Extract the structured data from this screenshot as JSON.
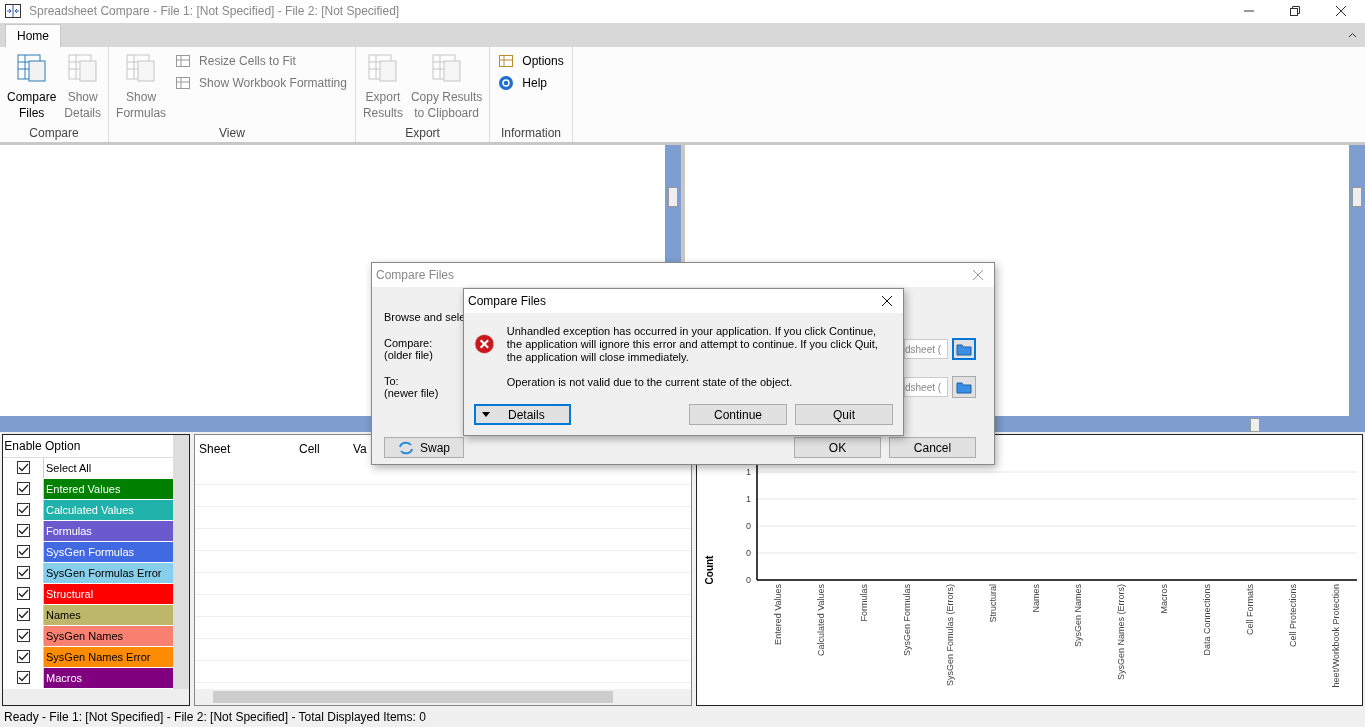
{
  "window": {
    "title": "Spreadsheet Compare - File 1: [Not Specified] - File 2: [Not Specified]"
  },
  "tabs": [
    {
      "label": "Home",
      "selected": true
    }
  ],
  "ribbon": {
    "groups": [
      {
        "label": "Compare",
        "items": [
          {
            "kind": "large",
            "label": "Compare\nFiles",
            "disabled": false
          },
          {
            "kind": "large",
            "label": "Show\nDetails",
            "disabled": true
          }
        ]
      },
      {
        "label": "View",
        "items": [
          {
            "kind": "large",
            "label": "Show\nFormulas",
            "disabled": true
          },
          {
            "kind": "small",
            "label": "Resize Cells to Fit",
            "disabled": true
          },
          {
            "kind": "small",
            "label": "Show Workbook Formatting",
            "disabled": true
          }
        ]
      },
      {
        "label": "Export",
        "items": [
          {
            "kind": "large",
            "label": "Export\nResults",
            "disabled": true
          },
          {
            "kind": "large",
            "label": "Copy Results\nto Clipboard",
            "disabled": true
          }
        ]
      },
      {
        "label": "Information",
        "items": [
          {
            "kind": "small",
            "label": "Options",
            "disabled": false
          },
          {
            "kind": "small",
            "label": "Help",
            "disabled": false
          }
        ]
      }
    ]
  },
  "options": {
    "columns": [
      "Enable",
      "Option"
    ],
    "rows": [
      {
        "label": "Select All",
        "checked": true
      },
      {
        "label": "Entered Values",
        "checked": true,
        "color": "#008000"
      },
      {
        "label": "Calculated Values",
        "checked": true,
        "color": "#20b2aa"
      },
      {
        "label": "Formulas",
        "checked": true,
        "color": "#6a5acd"
      },
      {
        "label": "SysGen Formulas",
        "checked": true,
        "color": "#4169e1"
      },
      {
        "label": "SysGen Formulas Error",
        "checked": true,
        "color": "#87ceeb"
      },
      {
        "label": "Structural",
        "checked": true,
        "color": "#ff0000"
      },
      {
        "label": "Names",
        "checked": true,
        "color": "#bdb76b"
      },
      {
        "label": "SysGen Names",
        "checked": true,
        "color": "#fa8072"
      },
      {
        "label": "SysGen Names Error",
        "checked": true,
        "color": "#ff8c00"
      },
      {
        "label": "Macros",
        "checked": true,
        "color": "#800080"
      }
    ]
  },
  "results": {
    "columns": [
      "Sheet",
      "Cell",
      "Va"
    ]
  },
  "chart": {
    "chart_data": {
      "type": "bar",
      "ylabel": "Count",
      "categories": [
        "Entered Values",
        "Calculated Values",
        "Formulas",
        "SysGen Formulas",
        "SysGen Fomulas (Errors)",
        "Structural",
        "Names",
        "SysGen Names",
        "SysGen Names (Errors)",
        "Macros",
        "Data Connections",
        "Cell Formats",
        "Cell Protections",
        "heet/Workbook Protection"
      ],
      "values": [
        0,
        0,
        0,
        0,
        0,
        0,
        0,
        0,
        0,
        0,
        0,
        0,
        0,
        0
      ],
      "ylim": [
        0,
        1
      ],
      "grid": true,
      "yticks": [
        {
          "value": 0,
          "label": "0"
        },
        {
          "value": 0.2,
          "label": "0"
        },
        {
          "value": 0.4,
          "label": "0"
        },
        {
          "value": 0.6,
          "label": "1"
        },
        {
          "value": 0.8,
          "label": "1"
        }
      ]
    }
  },
  "status_bar": "Ready - File 1: [Not Specified] - File 2: [Not Specified] - Total Displayed Items: 0",
  "compare_dialog": {
    "title": "Compare Files",
    "intro": "Browse and sele",
    "rows": [
      {
        "label": "Compare:",
        "sub": "(older file)",
        "value": "dsheet (",
        "focused": true
      },
      {
        "label": "To:",
        "sub": "(newer file)",
        "value": "dsheet (",
        "focused": false
      }
    ],
    "swap": "Swap",
    "ok": "OK",
    "cancel": "Cancel"
  },
  "error_dialog": {
    "title": "Compare Files",
    "message": "Unhandled exception has occurred in your application. If you click Continue, the application will ignore this error and attempt to continue. If you click Quit, the application will close immediately.",
    "detail": "Operation is not valid due to the current state of the object.",
    "details_button": "Details",
    "buttons": [
      "Continue",
      "Quit"
    ]
  }
}
